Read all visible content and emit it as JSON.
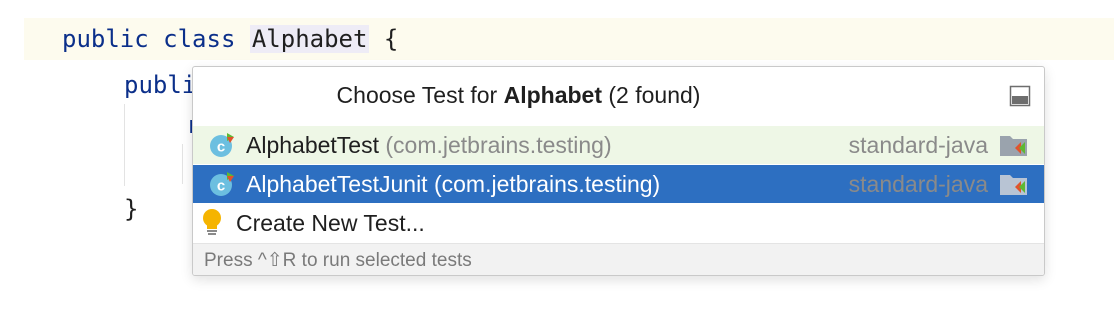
{
  "code": {
    "line1": {
      "kw": "public class ",
      "class_name": "Alphabet",
      "brace": " {"
    },
    "line2": "publi",
    "line3": "r",
    "line5": "}"
  },
  "popup": {
    "title_prefix": "Choose Test for ",
    "title_class": "Alphabet",
    "title_suffix": " (2 found)",
    "items": [
      {
        "name": "AlphabetTest",
        "package": " (com.jetbrains.testing)",
        "module": "standard-java",
        "icon": "test-class-icon",
        "selected": false
      },
      {
        "name": "AlphabetTestJunit",
        "package": " (com.jetbrains.testing)",
        "module": "standard-java",
        "icon": "test-class-icon",
        "selected": true
      }
    ],
    "create_label": "Create New Test...",
    "footer": "Press ^⇧R to run selected tests"
  },
  "colors": {
    "selection": "#2d6fc1",
    "hover": "#eef7e6",
    "keyword": "#0b2f8a"
  }
}
